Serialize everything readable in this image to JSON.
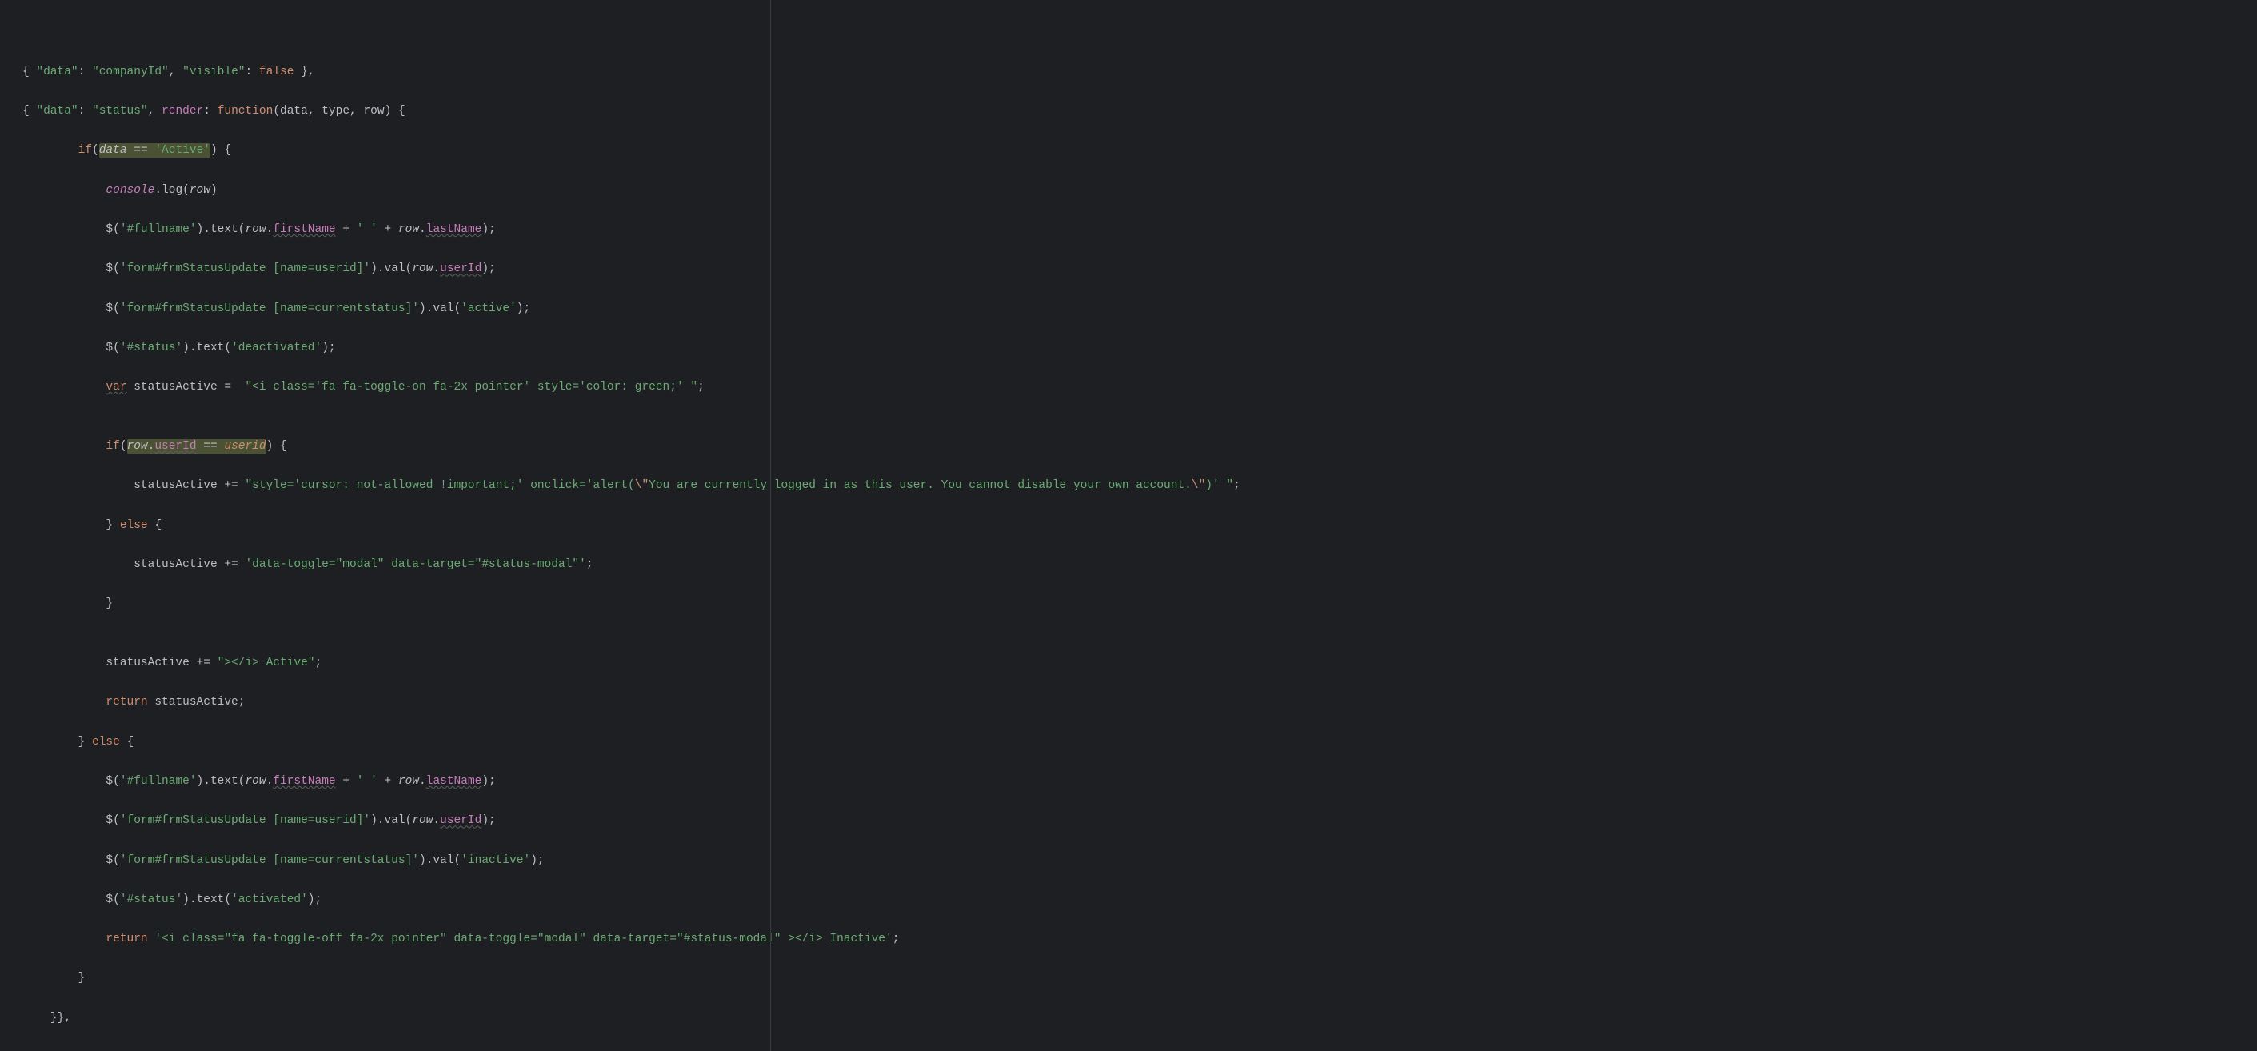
{
  "code": {
    "l1_a": "{ ",
    "l1_b": "\"data\"",
    "l1_c": ": ",
    "l1_d": "\"companyId\"",
    "l1_e": ", ",
    "l1_f": "\"visible\"",
    "l1_g": ": ",
    "l1_h": "false",
    "l1_i": " },",
    "l2_a": "{ ",
    "l2_b": "\"data\"",
    "l2_c": ": ",
    "l2_d": "\"status\"",
    "l2_e": ", ",
    "l2_f": "render",
    "l2_g": ": ",
    "l2_h": "function",
    "l2_i": "(",
    "l2_j": "data",
    "l2_k": ", ",
    "l2_l": "type",
    "l2_m": ", ",
    "l2_n": "row",
    "l2_o": ") {",
    "l3_pad": "        ",
    "l3_a": "if",
    "l3_b": "(",
    "l3_hl_a": "data",
    "l3_hl_b": " == ",
    "l3_hl_c": "'Active'",
    "l3_c": ") {",
    "l4_pad": "            ",
    "l4_a": "console",
    "l4_b": ".",
    "l4_c": "log",
    "l4_d": "(",
    "l4_e": "row",
    "l4_f": ")",
    "l5_pad": "            ",
    "l5_a": "$(",
    "l5_b": "'#fullname'",
    "l5_c": ").",
    "l5_d": "text",
    "l5_e": "(",
    "l5_f": "row",
    "l5_g": ".",
    "l5_h": "firstName",
    "l5_i": " + ",
    "l5_j": "' '",
    "l5_k": " + ",
    "l5_l": "row",
    "l5_m": ".",
    "l5_n": "lastName",
    "l5_o": ");",
    "l6_pad": "            ",
    "l6_a": "$(",
    "l6_b": "'form#frmStatusUpdate [name=userid]'",
    "l6_c": ").",
    "l6_d": "val",
    "l6_e": "(",
    "l6_f": "row",
    "l6_g": ".",
    "l6_h": "userId",
    "l6_i": ");",
    "l7_pad": "            ",
    "l7_a": "$(",
    "l7_b": "'form#frmStatusUpdate [name=currentstatus]'",
    "l7_c": ").",
    "l7_d": "val",
    "l7_e": "(",
    "l7_f": "'active'",
    "l7_g": ");",
    "l8_pad": "            ",
    "l8_a": "$(",
    "l8_b": "'#status'",
    "l8_c": ").",
    "l8_d": "text",
    "l8_e": "(",
    "l8_f": "'deactivated'",
    "l8_g": ");",
    "l9_pad": "            ",
    "l9_a": "var",
    "l9_b": " statusActive =  ",
    "l9_c": "\"<i class='fa fa-toggle-on fa-2x pointer' style='color: green;' \"",
    "l9_d": ";",
    "l10_pad": "",
    "l11_pad": "            ",
    "l11_a": "if",
    "l11_b": "(",
    "l11_hl_a": "row",
    "l11_hl_b": ".",
    "l11_hl_c": "userId",
    "l11_hl_d": " == ",
    "l11_hl_e": "userid",
    "l11_c": ") {",
    "l12_pad": "                ",
    "l12_a": "statusActive += ",
    "l12_b": "\"style='cursor: not-allowed !important;' onclick='alert(",
    "l12_c": "\\\"",
    "l12_d": "You are currently logged in as this user. You cannot disable your own account.",
    "l12_e": "\\\"",
    "l12_f": ")' \"",
    "l12_g": ";",
    "l13_pad": "            ",
    "l13_a": "} ",
    "l13_b": "else",
    "l13_c": " {",
    "l14_pad": "                ",
    "l14_a": "statusActive += ",
    "l14_b": "'data-toggle=\"modal\" data-target=\"#status-modal\"'",
    "l14_c": ";",
    "l15_pad": "            ",
    "l15_a": "}",
    "l16_pad": "",
    "l17_pad": "            ",
    "l17_a": "statusActive += ",
    "l17_b": "\"></i> Active\"",
    "l17_c": ";",
    "l18_pad": "            ",
    "l18_a": "return ",
    "l18_b": "statusActive;",
    "l19_pad": "        ",
    "l19_a": "} ",
    "l19_b": "else",
    "l19_c": " {",
    "l20_pad": "            ",
    "l20_a": "$(",
    "l20_b": "'#fullname'",
    "l20_c": ").",
    "l20_d": "text",
    "l20_e": "(",
    "l20_f": "row",
    "l20_g": ".",
    "l20_h": "firstName",
    "l20_i": " + ",
    "l20_j": "' '",
    "l20_k": " + ",
    "l20_l": "row",
    "l20_m": ".",
    "l20_n": "lastName",
    "l20_o": ");",
    "l21_pad": "            ",
    "l21_a": "$(",
    "l21_b": "'form#frmStatusUpdate [name=userid]'",
    "l21_c": ").",
    "l21_d": "val",
    "l21_e": "(",
    "l21_f": "row",
    "l21_g": ".",
    "l21_h": "userId",
    "l21_i": ");",
    "l22_pad": "            ",
    "l22_a": "$(",
    "l22_b": "'form#frmStatusUpdate [name=currentstatus]'",
    "l22_c": ").",
    "l22_d": "val",
    "l22_e": "(",
    "l22_f": "'inactive'",
    "l22_g": ");",
    "l23_pad": "            ",
    "l23_a": "$(",
    "l23_b": "'#status'",
    "l23_c": ").",
    "l23_d": "text",
    "l23_e": "(",
    "l23_f": "'activated'",
    "l23_g": ");",
    "l24_pad": "            ",
    "l24_a": "return ",
    "l24_b": "'<i class=\"fa fa-toggle-off fa-2x pointer\" data-toggle=\"modal\" data-target=\"#status-modal\" ></i> Inactive'",
    "l24_c": ";",
    "l25_pad": "        ",
    "l25_a": "}",
    "l26_pad": "    ",
    "l26_a": "}},"
  }
}
